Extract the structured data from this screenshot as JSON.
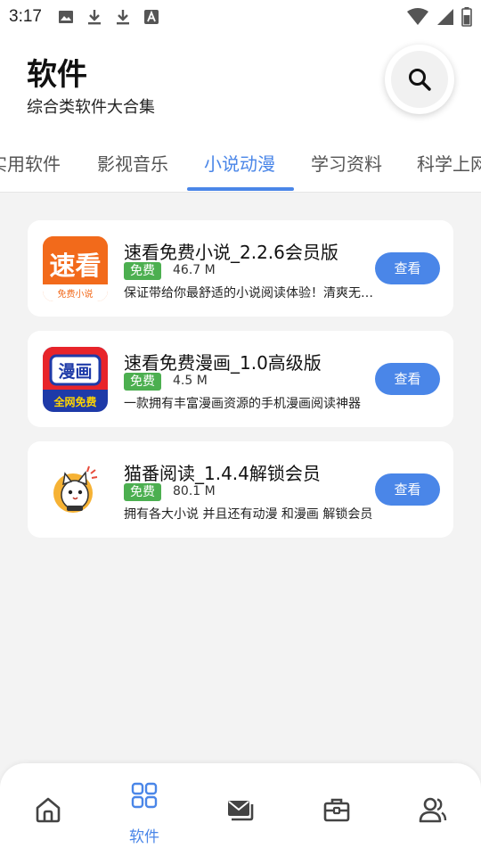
{
  "status_bar": {
    "time": "3:17",
    "icons_left": [
      "image-icon",
      "download-icon",
      "download-icon",
      "app-notification-icon"
    ],
    "icons_right": [
      "wifi-icon",
      "cell-signal-icon",
      "battery-icon"
    ]
  },
  "header": {
    "title": "软件",
    "subtitle": "综合类软件大合集",
    "search_icon": "search-icon"
  },
  "tabs": {
    "items": [
      "实用软件",
      "影视音乐",
      "小说动漫",
      "学习资料",
      "科学上网"
    ],
    "active_index": 2
  },
  "apps": [
    {
      "name": "速看免费小说_2.2.6会员版",
      "badge": "免费",
      "size": "46.7 M",
      "description": "保证带给你最舒适的小说阅读体验！清爽无广告",
      "button": "查看",
      "icon_text_main": "速看",
      "icon_text_sub": "免费小说"
    },
    {
      "name": "速看免费漫画_1.0高级版",
      "badge": "免费",
      "size": "4.5 M",
      "description": "一款拥有丰富漫画资源的手机漫画阅读神器",
      "button": "查看",
      "icon_text_main": "漫画",
      "icon_text_sub": "全网免费"
    },
    {
      "name": "猫番阅读_1.4.4解锁会员",
      "badge": "免费",
      "size": "80.1 M",
      "description": "拥有各大小说 并且还有动漫 和漫画 解锁会员",
      "button": "查看"
    }
  ],
  "bottom_nav": {
    "items": [
      {
        "icon": "home-icon",
        "label": ""
      },
      {
        "icon": "grid-apps-icon",
        "label": "软件"
      },
      {
        "icon": "mail-icon",
        "label": ""
      },
      {
        "icon": "toolbox-icon",
        "label": ""
      },
      {
        "icon": "users-icon",
        "label": ""
      }
    ],
    "active_index": 1
  },
  "colors": {
    "accent": "#4a86e8",
    "badge": "#4caf50",
    "background": "#f3f3f3"
  }
}
